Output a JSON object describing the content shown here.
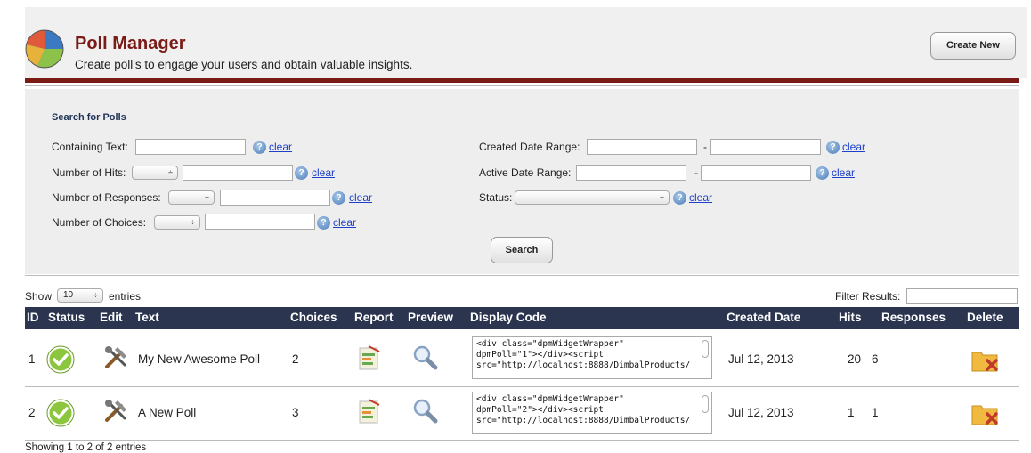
{
  "header": {
    "title": "Poll Manager",
    "subtitle": "Create poll's to engage your users and obtain valuable insights.",
    "create_label": "Create New"
  },
  "search": {
    "heading": "Search for Polls",
    "containing_text": "Containing Text:",
    "number_of_hits": "Number of Hits:",
    "number_of_responses": "Number of Responses:",
    "number_of_choices": "Number of Choices:",
    "created_date_range": "Created Date Range:",
    "active_date_range": "Active Date Range:",
    "status": "Status:",
    "dash": "-",
    "clear": "clear",
    "help": "?",
    "search_label": "Search"
  },
  "table_controls": {
    "show": "Show",
    "entries_value": "10",
    "entries": "entries",
    "filter": "Filter Results:"
  },
  "columns": [
    "ID",
    "Status",
    "Edit",
    "Text",
    "Choices",
    "Report",
    "Preview",
    "Display Code",
    "Created Date",
    "Hits",
    "Responses",
    "Delete"
  ],
  "rows": [
    {
      "id": "1",
      "text": "My New Awesome Poll",
      "choices": "2",
      "code": "<div class=\"dpmWidgetWrapper\"\ndpmPoll=\"1\"></div><script\nsrc=\"http://localhost:8888/DimbalProducts/",
      "created": "Jul 12, 2013",
      "hits": "20",
      "responses": "6"
    },
    {
      "id": "2",
      "text": "A New Poll",
      "choices": "3",
      "code": "<div class=\"dpmWidgetWrapper\"\ndpmPoll=\"2\"></div><script\nsrc=\"http://localhost:8888/DimbalProducts/",
      "created": "Jul 12, 2013",
      "hits": "1",
      "responses": "1"
    }
  ],
  "footer": "Showing 1 to 2 of 2 entries",
  "colors": {
    "brand": "#7a1b17",
    "table_header": "#2b3550",
    "link": "#1e40c8"
  }
}
